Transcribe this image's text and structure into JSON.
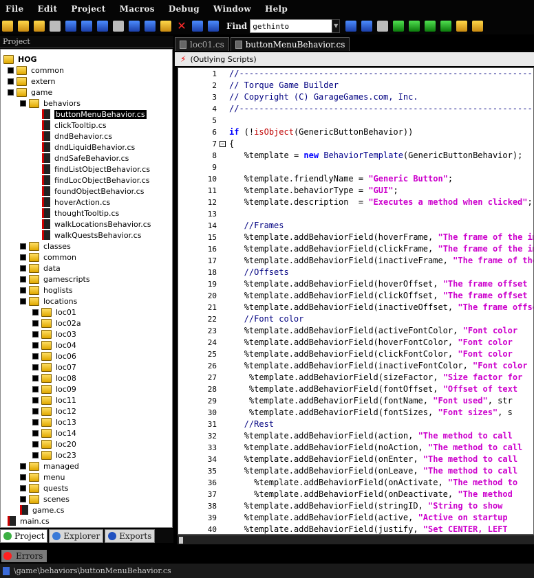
{
  "menu": [
    "File",
    "Edit",
    "Project",
    "Macros",
    "Debug",
    "Window",
    "Help"
  ],
  "toolbar": {
    "find_label": "Find",
    "find_value": "gethinto"
  },
  "left_panel": {
    "title": "Project"
  },
  "tree": [
    {
      "label": "HOG",
      "depth": 0,
      "type": "root"
    },
    {
      "label": "common",
      "depth": 1,
      "type": "folder"
    },
    {
      "label": "extern",
      "depth": 1,
      "type": "folder"
    },
    {
      "label": "game",
      "depth": 1,
      "type": "folder"
    },
    {
      "label": "behaviors",
      "depth": 2,
      "type": "folder"
    },
    {
      "label": "buttonMenuBehavior.cs",
      "depth": 3,
      "type": "file",
      "selected": true
    },
    {
      "label": "clickTooltip.cs",
      "depth": 3,
      "type": "file"
    },
    {
      "label": "dndBehavior.cs",
      "depth": 3,
      "type": "file"
    },
    {
      "label": "dndLiquidBehavior.cs",
      "depth": 3,
      "type": "file"
    },
    {
      "label": "dndSafeBehavior.cs",
      "depth": 3,
      "type": "file"
    },
    {
      "label": "findListObjectBehavior.cs",
      "depth": 3,
      "type": "file"
    },
    {
      "label": "findLocObjectBehavior.cs",
      "depth": 3,
      "type": "file"
    },
    {
      "label": "foundObjectBehavior.cs",
      "depth": 3,
      "type": "file"
    },
    {
      "label": "hoverAction.cs",
      "depth": 3,
      "type": "file"
    },
    {
      "label": "thoughtTooltip.cs",
      "depth": 3,
      "type": "file"
    },
    {
      "label": "walkLocationsBehavior.cs",
      "depth": 3,
      "type": "file"
    },
    {
      "label": "walkQuestsBehavior.cs",
      "depth": 3,
      "type": "file"
    },
    {
      "label": "classes",
      "depth": 2,
      "type": "folder"
    },
    {
      "label": "common",
      "depth": 2,
      "type": "folder"
    },
    {
      "label": "data",
      "depth": 2,
      "type": "folder"
    },
    {
      "label": "gamescripts",
      "depth": 2,
      "type": "folder"
    },
    {
      "label": "hoglists",
      "depth": 2,
      "type": "folder"
    },
    {
      "label": "locations",
      "depth": 2,
      "type": "folder"
    },
    {
      "label": "loc01",
      "depth": 3,
      "type": "folder"
    },
    {
      "label": "loc02a",
      "depth": 3,
      "type": "folder"
    },
    {
      "label": "loc03",
      "depth": 3,
      "type": "folder"
    },
    {
      "label": "loc04",
      "depth": 3,
      "type": "folder"
    },
    {
      "label": "loc06",
      "depth": 3,
      "type": "folder"
    },
    {
      "label": "loc07",
      "depth": 3,
      "type": "folder"
    },
    {
      "label": "loc08",
      "depth": 3,
      "type": "folder"
    },
    {
      "label": "loc09",
      "depth": 3,
      "type": "folder"
    },
    {
      "label": "loc11",
      "depth": 3,
      "type": "folder"
    },
    {
      "label": "loc12",
      "depth": 3,
      "type": "folder"
    },
    {
      "label": "loc13",
      "depth": 3,
      "type": "folder"
    },
    {
      "label": "loc14",
      "depth": 3,
      "type": "folder"
    },
    {
      "label": "loc20",
      "depth": 3,
      "type": "folder"
    },
    {
      "label": "loc23",
      "depth": 3,
      "type": "folder"
    },
    {
      "label": "managed",
      "depth": 2,
      "type": "folder"
    },
    {
      "label": "menu",
      "depth": 2,
      "type": "folder"
    },
    {
      "label": "quests",
      "depth": 2,
      "type": "folder"
    },
    {
      "label": "scenes",
      "depth": 2,
      "type": "folder"
    },
    {
      "label": "game.cs",
      "depth": 2,
      "type": "file"
    },
    {
      "label": "main.cs",
      "depth": 1,
      "type": "file"
    }
  ],
  "bottom_tabs": [
    "Project",
    "Explorer",
    "Exports"
  ],
  "errors_tab": "Errors",
  "status_text": "\\game\\behaviors\\buttonMenuBehavior.cs",
  "editor": {
    "tabs": [
      {
        "label": "loc01.cs"
      },
      {
        "label": "buttonMenuBehavior.cs",
        "active": true
      }
    ],
    "scope": "(Outlying Scripts)"
  },
  "code": [
    "//--------------------------------------------------------------------",
    "// Torque Game Builder",
    "// Copyright (C) GarageGames.com, Inc.",
    "//--------------------------------------------------------------------",
    "",
    "if (!isObject(GenericButtonBehavior))",
    "{",
    "   %template = new BehaviorTemplate(GenericButtonBehavior);",
    "",
    "   %template.friendlyName = \"Generic Button\";",
    "   %template.behaviorType = \"GUI\";",
    "   %template.description  = \"Executes a method when clicked\";",
    "",
    "   //Frames",
    "   %template.addBehaviorField(hoverFrame, \"The frame of the image",
    "   %template.addBehaviorField(clickFrame, \"The frame of the image",
    "   %template.addBehaviorField(inactiveFrame, \"The frame of the im",
    "   //Offsets",
    "   %template.addBehaviorField(hoverOffset, \"The frame offset",
    "   %template.addBehaviorField(clickOffset, \"The frame offset",
    "   %template.addBehaviorField(inactiveOffset, \"The frame offset",
    "   //Font color",
    "   %template.addBehaviorField(activeFontColor, \"Font color",
    "   %template.addBehaviorField(hoverFontColor, \"Font color",
    "   %template.addBehaviorField(clickFontColor, \"Font color",
    "   %template.addBehaviorField(inactiveFontColor, \"Font color",
    "    %template.addBehaviorField(sizeFactor, \"Size factor for",
    "    %template.addBehaviorField(fontOffset, \"Offset of text",
    "    %template.addBehaviorField(fontName, \"Font used\", str",
    "    %template.addBehaviorField(fontSizes, \"Font sizes\", s",
    "   //Rest",
    "   %template.addBehaviorField(action, \"The method to call",
    "   %template.addBehaviorField(noAction, \"The method to call",
    "   %template.addBehaviorField(onEnter, \"The method to call",
    "   %template.addBehaviorField(onLeave, \"The method to call",
    "     %template.addBehaviorField(onActivate, \"The method to",
    "     %template.addBehaviorField(onDeactivate, \"The method",
    "   %template.addBehaviorField(stringID, \"String to show",
    "   %template.addBehaviorField(active, \"Active on startup",
    "   %template.addBehaviorField(justify, \"Set CENTER, LEFT"
  ],
  "colors": {
    "keyword": "#0000ff",
    "string": "#cc00cc",
    "comment": "#000080",
    "call": "#c00000",
    "type": "#00008b"
  }
}
